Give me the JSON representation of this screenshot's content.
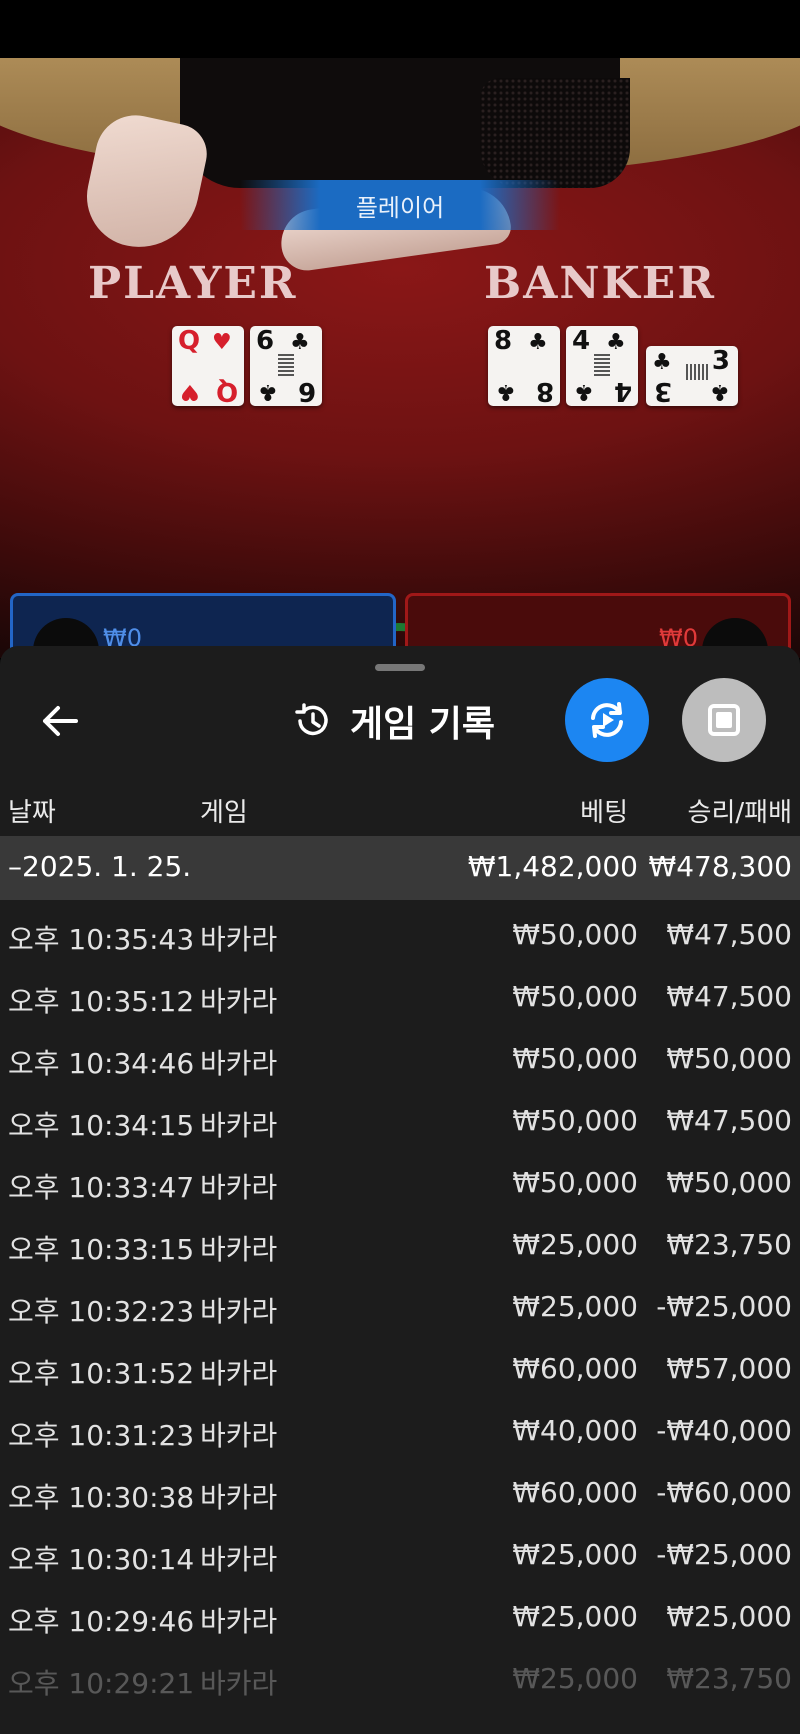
{
  "game_view": {
    "result_banner": "플레이어",
    "player_label": "PLAYER",
    "banker_label": "BANKER",
    "player_cards": [
      {
        "rank": "Q",
        "suit": "♥",
        "red": true
      },
      {
        "rank": "6",
        "suit": "♣",
        "red": false
      }
    ],
    "banker_cards": [
      {
        "rank": "8",
        "suit": "♣",
        "red": false
      },
      {
        "rank": "4",
        "suit": "♣",
        "red": false
      },
      {
        "rank": "3",
        "suit": "♣",
        "red": false
      }
    ],
    "player_bet": "₩0",
    "banker_bet": "₩0"
  },
  "sheet": {
    "title": "게임 기록",
    "icons": {
      "back": "arrow-left-icon",
      "history": "history-icon",
      "replay": "replay-icon",
      "stop": "stop-icon"
    },
    "columns": {
      "date": "날짜",
      "game": "게임",
      "bet": "베팅",
      "win_loss": "승리/패배"
    },
    "date_group": {
      "date": "–2025. 1. 25.",
      "total_bet": "₩1,482,000",
      "total_win_loss": "₩478,300"
    },
    "rows": [
      {
        "time": "오후 10:35:43",
        "game": "바카라",
        "bet": "₩50,000",
        "win_loss": "₩47,500"
      },
      {
        "time": "오후 10:35:12",
        "game": "바카라",
        "bet": "₩50,000",
        "win_loss": "₩47,500"
      },
      {
        "time": "오후 10:34:46",
        "game": "바카라",
        "bet": "₩50,000",
        "win_loss": "₩50,000"
      },
      {
        "time": "오후 10:34:15",
        "game": "바카라",
        "bet": "₩50,000",
        "win_loss": "₩47,500"
      },
      {
        "time": "오후 10:33:47",
        "game": "바카라",
        "bet": "₩50,000",
        "win_loss": "₩50,000"
      },
      {
        "time": "오후 10:33:15",
        "game": "바카라",
        "bet": "₩25,000",
        "win_loss": "₩23,750"
      },
      {
        "time": "오후 10:32:23",
        "game": "바카라",
        "bet": "₩25,000",
        "win_loss": "-₩25,000"
      },
      {
        "time": "오후 10:31:52",
        "game": "바카라",
        "bet": "₩60,000",
        "win_loss": "₩57,000"
      },
      {
        "time": "오후 10:31:23",
        "game": "바카라",
        "bet": "₩40,000",
        "win_loss": "-₩40,000"
      },
      {
        "time": "오후 10:30:38",
        "game": "바카라",
        "bet": "₩60,000",
        "win_loss": "-₩60,000"
      },
      {
        "time": "오후 10:30:14",
        "game": "바카라",
        "bet": "₩25,000",
        "win_loss": "-₩25,000"
      },
      {
        "time": "오후 10:29:46",
        "game": "바카라",
        "bet": "₩25,000",
        "win_loss": "₩25,000"
      },
      {
        "time": "오후 10:29:21",
        "game": "바카라",
        "bet": "₩25,000",
        "win_loss": "₩23,750"
      }
    ]
  }
}
